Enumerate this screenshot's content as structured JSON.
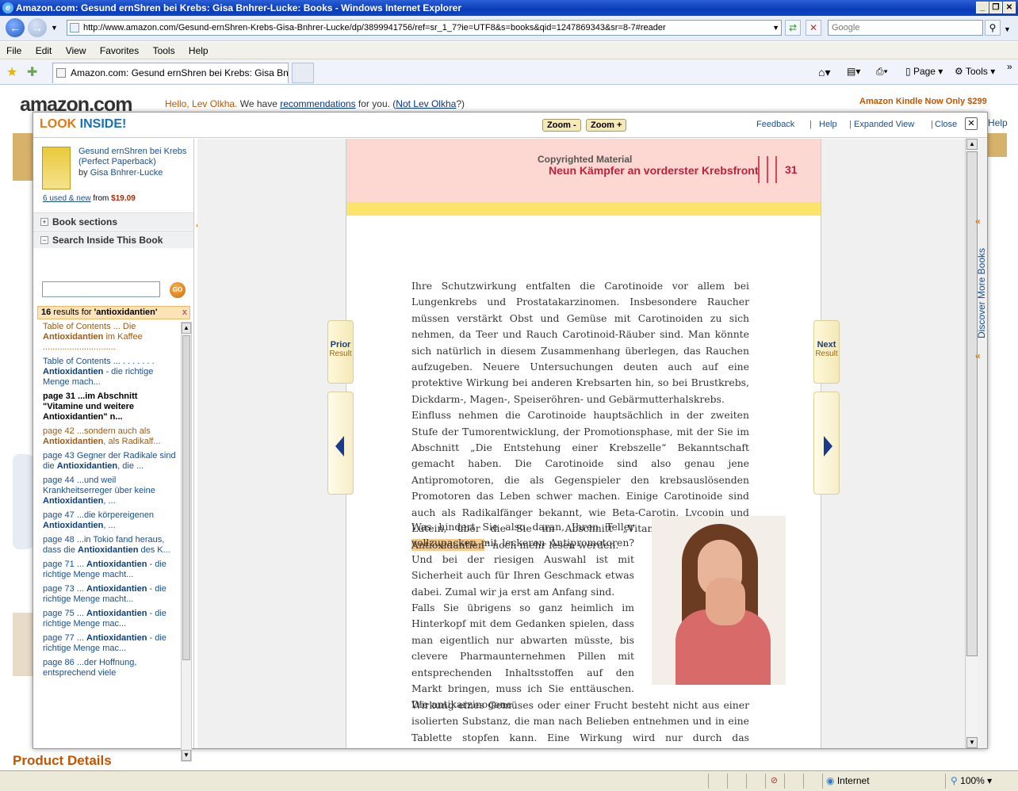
{
  "window": {
    "title": "Amazon.com: Gesund ernShren bei Krebs: Gisa Bnhrer-Lucke: Books - Windows Internet Explorer"
  },
  "address": {
    "url": "http://www.amazon.com/Gesund-ernShren-Krebs-Gisa-Bnhrer-Lucke/dp/3899941756/ref=sr_1_7?ie=UTF8&s=books&qid=1247869343&sr=8-7#reader",
    "search_placeholder": "Google"
  },
  "menu": [
    "File",
    "Edit",
    "View",
    "Favorites",
    "Tools",
    "Help"
  ],
  "tab": {
    "label": "Amazon.com: Gesund ernShren bei Krebs: Gisa Bnhre..."
  },
  "commandbar": {
    "page_label": "Page",
    "tools_label": "Tools"
  },
  "background": {
    "logo": "amazon.com",
    "hello_prefix": "Hello, Lev Olkha.",
    "hello_mid": " We have ",
    "recommendations": "recommendations",
    "hello_mid2": " for you. (",
    "not_user": "Not Lev Olkha",
    "hello_end": "?)",
    "kindle": "Amazon Kindle Now Only $299",
    "product_details": "Product Details",
    "help_link": "Help"
  },
  "overlay": {
    "look": "LOOK",
    "inside": "INSIDE!",
    "zoom_out": "Zoom -",
    "zoom_in": "Zoom +",
    "feedback": "Feedback",
    "help": "Help",
    "expanded": "Expanded View",
    "close": "Close"
  },
  "book": {
    "title": "Gesund ernShren bei Krebs (Perfect Paperback)",
    "by": "by",
    "author": "Gisa Bnhrer-Lucke",
    "used_link": "6 used & new",
    "from": " from ",
    "price": "$19.09"
  },
  "panel": {
    "book_sections": "Book sections",
    "search_inside": "Search Inside This Book",
    "go": "GO",
    "results_count": "16",
    "results_text": " results for ",
    "results_query": "'antioxidantien'"
  },
  "results": [
    {
      "pre": "Table of Contents ... Die ",
      "hl": "Antioxidantien",
      "post": " im Kaffee ..............................",
      "style": "brown"
    },
    {
      "pre": "Table of Contents ... . . . . . . . ",
      "hl": "Antioxidantien",
      "post": " - die richtige Menge mach...",
      "style": "blue"
    },
    {
      "pre": "page 31 ...im Abschnitt \"Vitamine und weitere ",
      "hl": "Antioxidantien",
      "post": "\" n...",
      "style": "cur"
    },
    {
      "pre": "page 42 ...sondern auch als ",
      "hl": "Antioxidantien",
      "post": ", als Radikalf...",
      "style": "brown"
    },
    {
      "pre": "page 43 Gegner der Radikale sind die ",
      "hl": "Antioxidantien",
      "post": ", die ...",
      "style": "blue"
    },
    {
      "pre": "page 44 ...und weil Krankheitserreger über keine ",
      "hl": "Antioxidantien",
      "post": ", ...",
      "style": "blue"
    },
    {
      "pre": "page 47 ...die körpereigenen ",
      "hl": "Antioxidantien",
      "post": ", ...",
      "style": "blue"
    },
    {
      "pre": "page 48 ...in Tokio fand heraus, dass die ",
      "hl": "Antioxidantien",
      "post": " des K...",
      "style": "blue"
    },
    {
      "pre": "page 71 ... ",
      "hl": "Antioxidantien",
      "post": " - die richtige Menge macht...",
      "style": "blue"
    },
    {
      "pre": "page 73 ... ",
      "hl": "Antioxidantien",
      "post": " - die richtige Menge macht...",
      "style": "blue"
    },
    {
      "pre": "page 75 ... ",
      "hl": "Antioxidantien",
      "post": " - die richtige Menge mac...",
      "style": "blue"
    },
    {
      "pre": "page 77 ... ",
      "hl": "Antioxidantien",
      "post": " - die richtige Menge mac...",
      "style": "blue"
    },
    {
      "pre": "page 86 ...der Hoffnung, entsprechend viele",
      "hl": "",
      "post": "",
      "style": "blue"
    }
  ],
  "page": {
    "copyright": "Copyrighted Material",
    "chapter": "Neun Kämpfer an vorderster Krebsfront",
    "number": "31",
    "para1": "Ihre Schutzwirkung entfalten die Carotinoide vor allem bei Lungenkrebs und Prostatakarzinomen. Insbesondere Raucher müssen verstärkt Obst und Gemüse mit Carotinoiden zu sich nehmen, da Teer und Rauch Carotinoid-Räuber sind. Man könnte sich natürlich in diesem Zusammenhang überlegen, das Rauchen aufzugeben. Neuere Untersuchungen deuten auch auf eine protektive Wirkung bei anderen Krebsarten hin, so bei Brustkrebs, Dickdarm-, Magen-, Speiseröhren- und Gebärmutterhalskrebs.",
    "para2_pre": "Einfluss nehmen die Carotinoide hauptsächlich in der zweiten Stufe der Tumorentwicklung, der Promotionsphase, mit der Sie im Abschnitt „Die Entstehung einer Krebszelle“ Bekanntschaft gemacht haben. Die Carotinoide sind also genau jene Antipromotoren, die als Gegenspieler den krebsauslösenden Promotoren das Leben schwer machen. Einige Carotinoide sind auch als Radikalfänger bekannt, wie Beta-Carotin, Lycopin und Lutein, über die Sie im Abschnitt „Vitamine und weitere ",
    "para2_hl": "Antioxidantien",
    "para2_post": "“ noch mehr lesen werden.",
    "col2": "Was hindert Sie also daran, Ihren Teller vollzupacken mit leckeren Antipromotoren? Und bei der riesigen Auswahl ist mit Sicherheit auch für Ihren Geschmack etwas dabei. Zumal wir ja erst am Anfang sind.\nFalls Sie übrigens so ganz heimlich im Hinterkopf mit dem Gedanken spielen, dass man eigentlich nur abwarten müsste, bis clevere Pharmaunternehmen Pillen mit entsprechenden Inhaltsstoffen auf den Markt bringen, muss ich Sie enttäuschen. Die antikarzinogene",
    "col3": "Wirkung eines Gemüses oder einer Frucht besteht nicht aus einer isolierten Substanz, die man nach Belieben entnehmen und in eine Tablette stopfen kann. Eine Wirkung wird nur durch das komplizierte Wechsel-"
  },
  "nav": {
    "prior": "Prior",
    "next": "Next",
    "result": "Result"
  },
  "discover": "Discover More Books",
  "status": {
    "zone": "Internet",
    "zoom": "100%"
  }
}
